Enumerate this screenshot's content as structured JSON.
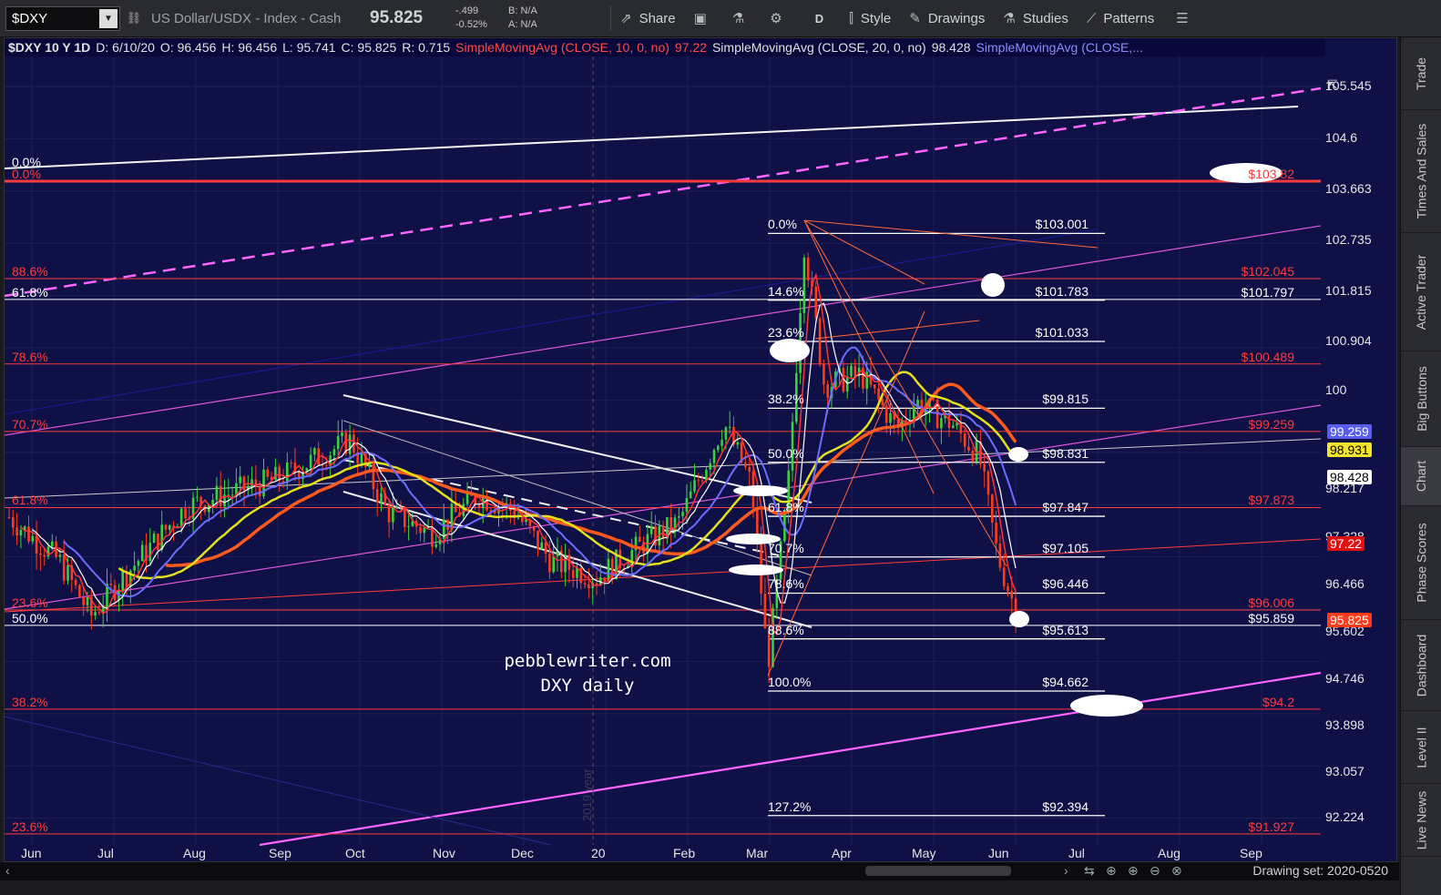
{
  "toolbar": {
    "symbol": "$DXY",
    "description": "US Dollar/USDX - Index - Cash",
    "price": "95.825",
    "change": "-.499",
    "change_pct": "-0.52%",
    "bid": "B: N/A",
    "ask": "A: N/A",
    "share_label": "Share",
    "period_label": "D",
    "style_label": "Style",
    "drawings_label": "Drawings",
    "studies_label": "Studies",
    "patterns_label": "Patterns"
  },
  "info_strip": {
    "symbol_period": "$DXY 10 Y 1D",
    "date": "D: 6/10/20",
    "open": "O: 96.456",
    "high": "H: 96.456",
    "low": "L: 95.741",
    "close": "C: 95.825",
    "range": "R: 0.715",
    "sma10": "SimpleMovingAvg (CLOSE, 10, 0, no)",
    "sma10_value": "97.22",
    "sma20": "SimpleMovingAvg (CLOSE, 20, 0, no)",
    "sma20_value": "98.428",
    "sma_next": "SimpleMovingAvg (CLOSE,..."
  },
  "price_axis": [
    "105.545",
    "104.6",
    "103.663",
    "102.735",
    "101.815",
    "100.904",
    "100",
    "98.217",
    "97.328",
    "96.466",
    "95.602",
    "94.746",
    "93.898",
    "93.057",
    "92.224"
  ],
  "price_tags": [
    {
      "value": "99.259",
      "bg": "#5a5cf0",
      "fg": "#ffffff"
    },
    {
      "value": "98.931",
      "bg": "#f2e52a",
      "fg": "#000000"
    },
    {
      "value": "98.428",
      "bg": "#ffffff",
      "fg": "#000000"
    },
    {
      "value": "97.22",
      "bg": "#e01010",
      "fg": "#ffffff"
    },
    {
      "value": "95.825",
      "bg": "#ff3b1a",
      "fg": "#ffffff"
    }
  ],
  "time_axis": [
    "Jun",
    "Jul",
    "Aug",
    "Sep",
    "Oct",
    "Nov",
    "Dec",
    "20",
    "Feb",
    "Mar",
    "Apr",
    "May",
    "Jun",
    "Jul",
    "Aug",
    "Sep"
  ],
  "fib_white": [
    {
      "pct": "0.0%",
      "price": "$103.001"
    },
    {
      "pct": "14.6%",
      "price": "$101.783"
    },
    {
      "pct": "23.6%",
      "price": "$101.033"
    },
    {
      "pct": "38.2%",
      "price": "$99.815"
    },
    {
      "pct": "50.0%",
      "price": "$98.831"
    },
    {
      "pct": "61.8%",
      "price": "$97.847"
    },
    {
      "pct": "70.7%",
      "price": "$97.105"
    },
    {
      "pct": "78.6%",
      "price": "$96.446"
    },
    {
      "pct": "88.6%",
      "price": "$95.613"
    },
    {
      "pct": "100.0%",
      "price": "$94.662"
    },
    {
      "pct": "127.2%",
      "price": "$92.394"
    }
  ],
  "fib_red": [
    {
      "pct": "0.0%",
      "price": "$103.82"
    },
    {
      "pct": "88.6%",
      "price": "$102.045"
    },
    {
      "pct": "78.6%",
      "price": "$100.489"
    },
    {
      "pct": "70.7%",
      "price": "$99.259"
    },
    {
      "pct": "61.8%",
      "price": "$97.873"
    },
    {
      "pct": "23.6%",
      "price": "$96.006"
    },
    {
      "pct": "38.2%",
      "price": "$94.2"
    },
    {
      "pct": "23.6%",
      "price": "$91.927"
    }
  ],
  "fib_white_left": [
    {
      "pct": "0.0%"
    },
    {
      "pct": "61.8%",
      "price": "$101.797"
    },
    {
      "pct": "50.0%",
      "price": "$95.859"
    }
  ],
  "watermark": {
    "line1": "pebblewriter.com",
    "line2": "DXY daily"
  },
  "year_marker": "2019 year",
  "scrollbar": {
    "drawing_set": "Drawing set: 2020-0520"
  },
  "side_tabs": [
    "Trade",
    "Times And Sales",
    "Active Trader",
    "Big Buttons",
    "Chart",
    "Phase Scores",
    "Dashboard",
    "Level II",
    "Live News"
  ],
  "colors": {
    "background": "#0f1045",
    "sma10": "#ff3333",
    "sma200": "#ff5a1e",
    "sma50": "#6c6cff",
    "yellow": "#e4e01c",
    "fib_red": "#ff3b3b",
    "channel_pink": "#ff66ff"
  }
}
